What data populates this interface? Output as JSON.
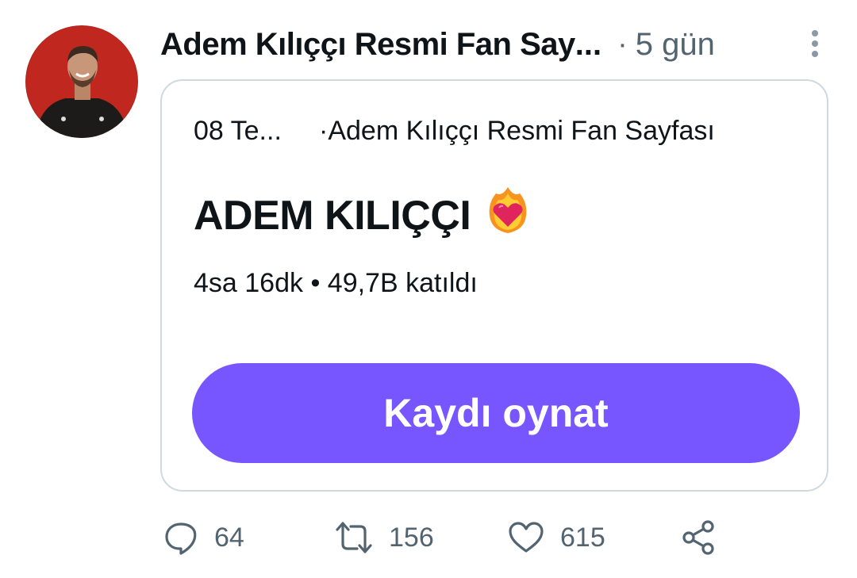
{
  "tweet": {
    "author_name": "Adem Kılıççı Resmi Fan Say",
    "author_ellipsis": "...",
    "separator": "·",
    "time_ago": "5 gün",
    "more_icon": "more-vertical-icon"
  },
  "space_card": {
    "date": "08 Te...",
    "host_separator": "·",
    "host": "Adem Kılıççı Resmi Fan Sayfası",
    "title": "ADEM KILIÇÇI",
    "title_emoji": "heart-on-fire-icon",
    "stats": "4sa 16dk • 49,7B katıldı",
    "play_button_label": "Kaydı oynat",
    "accent_color": "#7856ff"
  },
  "actions": {
    "reply": {
      "icon": "reply-icon",
      "count": "64"
    },
    "retweet": {
      "icon": "retweet-icon",
      "count": "156"
    },
    "like": {
      "icon": "heart-icon",
      "count": "615"
    },
    "share": {
      "icon": "share-icon"
    }
  }
}
